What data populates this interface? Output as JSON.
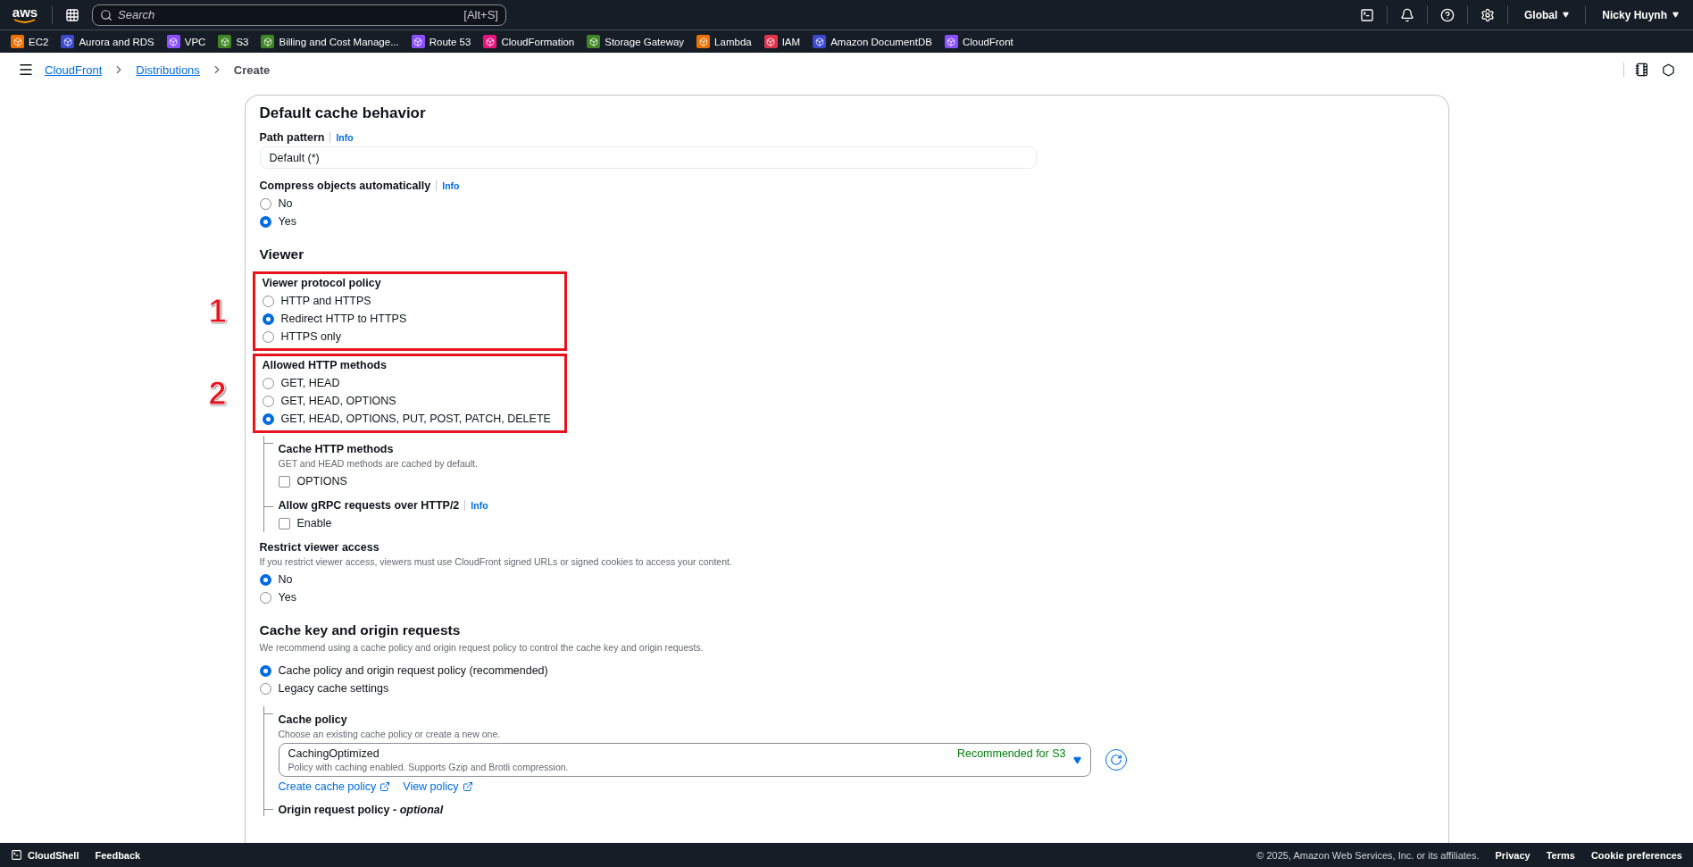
{
  "top_nav": {
    "logo": "aws",
    "search": {
      "placeholder": "Search",
      "shortcut": "[Alt+S]"
    },
    "region": "Global",
    "user": "Nicky Huynh"
  },
  "services": [
    {
      "label": "EC2",
      "color": "#ed7100"
    },
    {
      "label": "Aurora and RDS",
      "color": "#3b48cc"
    },
    {
      "label": "VPC",
      "color": "#8c4fff"
    },
    {
      "label": "S3",
      "color": "#3f8624"
    },
    {
      "label": "Billing and Cost Manage...",
      "color": "#3f8624"
    },
    {
      "label": "Route 53",
      "color": "#8c4fff"
    },
    {
      "label": "CloudFormation",
      "color": "#e7157b"
    },
    {
      "label": "Storage Gateway",
      "color": "#3f8624"
    },
    {
      "label": "Lambda",
      "color": "#ed7100"
    },
    {
      "label": "IAM",
      "color": "#dd344c"
    },
    {
      "label": "Amazon DocumentDB",
      "color": "#3b48cc"
    },
    {
      "label": "CloudFront",
      "color": "#8c4fff"
    }
  ],
  "breadcrumbs": [
    {
      "label": "CloudFront",
      "link": true
    },
    {
      "label": "Distributions",
      "link": true
    },
    {
      "label": "Create",
      "link": false
    }
  ],
  "form": {
    "title": "Default cache behavior",
    "path_pattern": {
      "label": "Path pattern",
      "info": "Info",
      "value": "Default (*)"
    },
    "compress": {
      "label": "Compress objects automatically",
      "info": "Info",
      "options": [
        {
          "label": "No",
          "selected": false
        },
        {
          "label": "Yes",
          "selected": true
        }
      ]
    },
    "viewer": {
      "heading": "Viewer",
      "protocol_policy": {
        "label": "Viewer protocol policy",
        "marker": "1",
        "options": [
          {
            "label": "HTTP and HTTPS",
            "selected": false
          },
          {
            "label": "Redirect HTTP to HTTPS",
            "selected": true
          },
          {
            "label": "HTTPS only",
            "selected": false
          }
        ]
      },
      "allowed_methods": {
        "label": "Allowed HTTP methods",
        "marker": "2",
        "options": [
          {
            "label": "GET, HEAD",
            "selected": false
          },
          {
            "label": "GET, HEAD, OPTIONS",
            "selected": false
          },
          {
            "label": "GET, HEAD, OPTIONS, PUT, POST, PATCH, DELETE",
            "selected": true
          }
        ]
      },
      "cache_methods": {
        "label": "Cache HTTP methods",
        "description": "GET and HEAD methods are cached by default.",
        "checkbox": {
          "label": "OPTIONS",
          "checked": false
        }
      },
      "grpc": {
        "label": "Allow gRPC requests over HTTP/2",
        "info": "Info",
        "checkbox": {
          "label": "Enable",
          "checked": false
        }
      },
      "restrict": {
        "label": "Restrict viewer access",
        "description": "If you restrict viewer access, viewers must use CloudFront signed URLs or signed cookies to access your content.",
        "options": [
          {
            "label": "No",
            "selected": true
          },
          {
            "label": "Yes",
            "selected": false
          }
        ]
      }
    },
    "cache_key": {
      "heading": "Cache key and origin requests",
      "description": "We recommend using a cache policy and origin request policy to control the cache key and origin requests.",
      "options": [
        {
          "label": "Cache policy and origin request policy (recommended)",
          "selected": true
        },
        {
          "label": "Legacy cache settings",
          "selected": false
        }
      ],
      "cache_policy": {
        "label": "Cache policy",
        "description": "Choose an existing cache policy or create a new one.",
        "select": {
          "value": "CachingOptimized",
          "description": "Policy with caching enabled. Supports Gzip and Brotli compression.",
          "badge": "Recommended for S3"
        },
        "links": [
          "Create cache policy",
          "View policy"
        ]
      },
      "origin_policy": {
        "label": "Origin request policy - *optional*"
      }
    }
  },
  "footer": {
    "cloudshell": "CloudShell",
    "feedback": "Feedback",
    "copyright": "© 2025, Amazon Web Services, Inc. or its affiliates.",
    "links": [
      "Privacy",
      "Terms",
      "Cookie preferences"
    ]
  }
}
